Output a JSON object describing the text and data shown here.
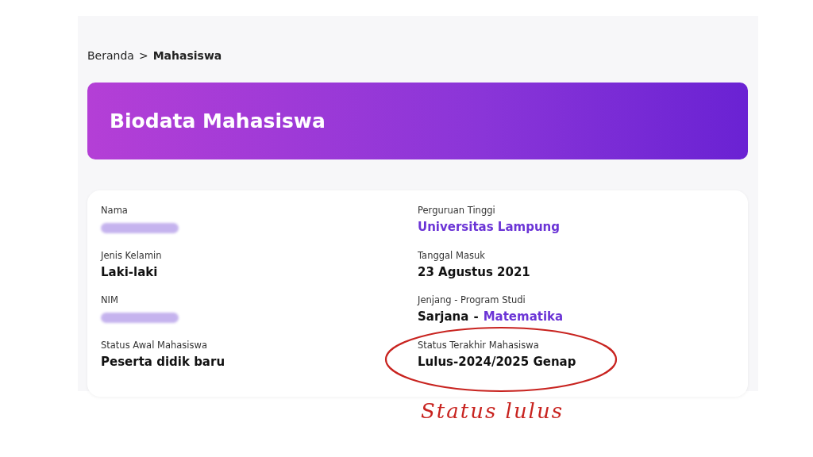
{
  "breadcrumb": [
    {
      "label": "Beranda",
      "current": false
    },
    {
      "label": "Mahasiswa",
      "current": true
    }
  ],
  "breadcrumb_separator": ">",
  "banner": {
    "title": "Biodata Mahasiswa"
  },
  "columns": [
    [
      {
        "label": "Nama",
        "kind": "redacted"
      },
      {
        "label": "Jenis Kelamin",
        "kind": "text",
        "value": [
          {
            "text": "Laki-laki",
            "link": false
          }
        ]
      },
      {
        "label": "NIM",
        "kind": "redacted"
      },
      {
        "label": "Status Awal Mahasiswa",
        "kind": "text",
        "value": [
          {
            "text": "Peserta didik baru",
            "link": false
          }
        ]
      }
    ],
    [
      {
        "label": "Perguruan Tinggi",
        "kind": "text",
        "value": [
          {
            "text": "Universitas Lampung",
            "link": true
          }
        ]
      },
      {
        "label": "Tanggal Masuk",
        "kind": "text",
        "value": [
          {
            "text": "23 Agustus 2021",
            "link": false
          }
        ]
      },
      {
        "label": "Jenjang - Program Studi",
        "kind": "text",
        "value": [
          {
            "text": "Sarjana",
            "link": false
          },
          {
            "text": "-",
            "link": false
          },
          {
            "text": "Matematika",
            "link": true
          }
        ]
      },
      {
        "label": "Status Terakhir Mahasiswa",
        "kind": "text",
        "circled": true,
        "value": [
          {
            "text": "Lulus-2024/2025 Genap",
            "link": false
          }
        ]
      }
    ]
  ],
  "annotation": "Status lulus"
}
